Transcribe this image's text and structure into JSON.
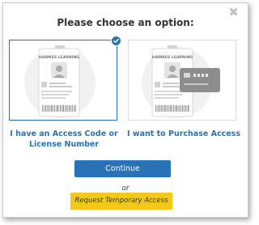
{
  "dialog": {
    "title": "Please choose an option:",
    "close_glyph": "✖"
  },
  "options": [
    {
      "label": "I have an Access Code or License Number",
      "badge_text": "HAWKES LEARNING",
      "icon": "id-badge-icon",
      "selected": true
    },
    {
      "label": "I want to Purchase Access",
      "badge_text": "HAWKES LEARNING",
      "icon": "id-badge-with-credit-card-icon",
      "selected": false
    }
  ],
  "continue_label": "Continue",
  "or_text": "or",
  "temporary_access_label": "Request Temporary Access",
  "colors": {
    "accent": "#2a72b5",
    "temporary_button": "#f2c81a",
    "close": "#c2c2c2"
  }
}
